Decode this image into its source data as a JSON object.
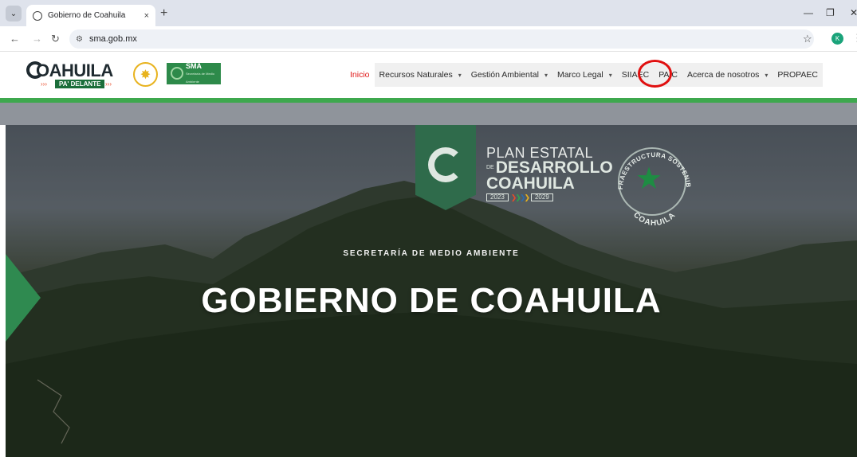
{
  "browser": {
    "tab_title": "Gobierno de Coahuila",
    "tab_close": "×",
    "new_tab": "+",
    "url": "sma.gob.mx",
    "profile_initial": "K"
  },
  "site_header": {
    "logo": {
      "word": "OAHUILA",
      "tagline": "PA' DELANTE",
      "seal_text": "A PASOS DE GIGANTE",
      "sma_label": "SMA",
      "sma_sub": "Secretaría de Medio Ambiente"
    },
    "nav": [
      {
        "label": "Inicio",
        "active": true,
        "dropdown": false
      },
      {
        "label": "Recursos Naturales",
        "active": false,
        "dropdown": true
      },
      {
        "label": "Gestión Ambiental",
        "active": false,
        "dropdown": true
      },
      {
        "label": "Marco Legal",
        "active": false,
        "dropdown": true
      },
      {
        "label": "SIIAEC",
        "active": false,
        "dropdown": false
      },
      {
        "label": "PAIC",
        "active": false,
        "dropdown": false
      },
      {
        "label": "Acerca de nosotros",
        "active": false,
        "dropdown": true
      },
      {
        "label": "PROPAEC",
        "active": false,
        "dropdown": false
      }
    ],
    "caret": "▾"
  },
  "hero": {
    "plan": {
      "line1": "PLAN ESTATAL",
      "prefix": "DE",
      "line2": "DESARROLLO",
      "line3": "COAHUILA",
      "year_start": "2023",
      "year_end": "2029"
    },
    "infra_top": "INFRAESTRUCTURA SOSTENIBLE",
    "infra_bottom": "COAHUILA",
    "kicker": "SECRETARÍA DE MEDIO AMBIENTE",
    "title": "GOBIERNO DE COAHUILA"
  },
  "colors": {
    "brand_green": "#3ea84e",
    "active_nav": "#e01818",
    "highlight": "#e01010"
  }
}
